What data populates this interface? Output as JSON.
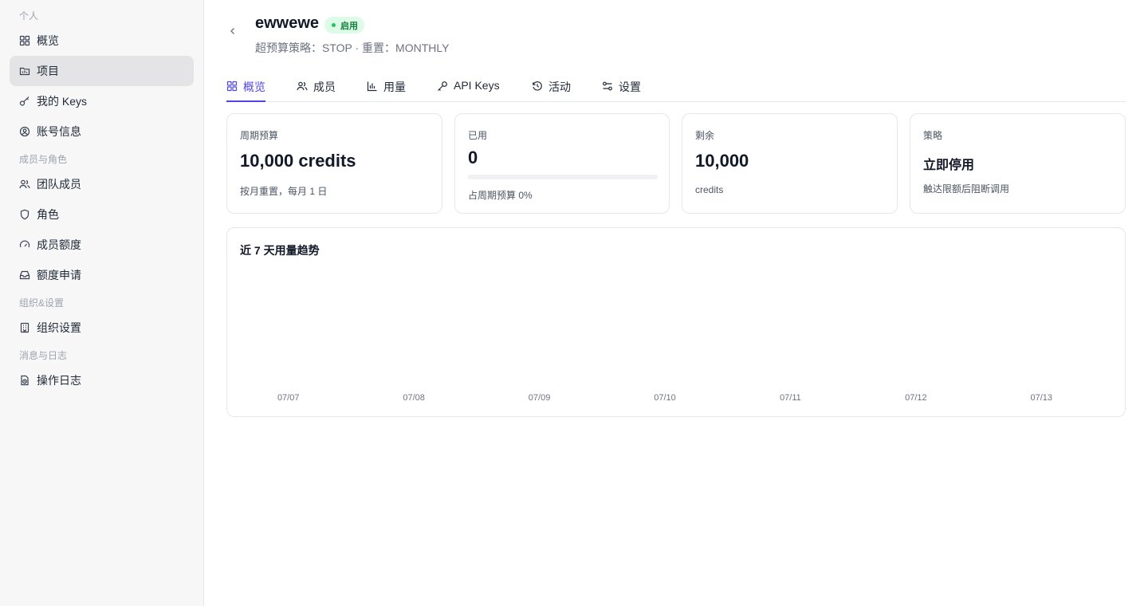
{
  "sidebar": {
    "sections": [
      {
        "label": "个人",
        "items": [
          {
            "label": "概览",
            "icon": "grid-icon"
          },
          {
            "label": "项目",
            "icon": "folder-icon",
            "active": true
          },
          {
            "label": "我的 Keys",
            "icon": "key-icon"
          },
          {
            "label": "账号信息",
            "icon": "user-circle-icon"
          }
        ]
      },
      {
        "label": "成员与角色",
        "items": [
          {
            "label": "团队成员",
            "icon": "users-icon"
          },
          {
            "label": "角色",
            "icon": "shield-icon"
          },
          {
            "label": "成员额度",
            "icon": "gauge-icon"
          },
          {
            "label": "额度申请",
            "icon": "inbox-icon"
          }
        ]
      },
      {
        "label": "组织&设置",
        "items": [
          {
            "label": "组织设置",
            "icon": "building-icon"
          }
        ]
      },
      {
        "label": "消息与日志",
        "items": [
          {
            "label": "操作日志",
            "icon": "log-icon"
          }
        ]
      }
    ]
  },
  "project": {
    "name": "ewwewe",
    "status": "启用",
    "subtitle": "超预算策略：STOP · 重置：MONTHLY"
  },
  "tabs": [
    {
      "label": "概览",
      "icon": "grid-icon",
      "active": true
    },
    {
      "label": "成员",
      "icon": "users-icon"
    },
    {
      "label": "用量",
      "icon": "bar-chart-icon"
    },
    {
      "label": "API Keys",
      "icon": "key-icon"
    },
    {
      "label": "活动",
      "icon": "history-icon"
    },
    {
      "label": "设置",
      "icon": "sliders-icon"
    }
  ],
  "cards": {
    "budget": {
      "label": "周期预算",
      "value": "10,000 credits",
      "note": "按月重置，每月 1 日"
    },
    "used": {
      "label": "已用",
      "value": "0",
      "note": "占周期预算 0%",
      "progress": 0
    },
    "remaining": {
      "label": "剩余",
      "value": "10,000",
      "note": "credits"
    },
    "policy": {
      "label": "策略",
      "value": "立即停用",
      "note": "触达限额后阻断调用"
    }
  },
  "colors": {
    "accent": "#4f46e5",
    "status_green": "#15803d",
    "status_bg": "#dcfce7"
  },
  "chart_data": {
    "type": "bar",
    "title": "近 7 天用量趋势",
    "categories": [
      "07/07",
      "07/08",
      "07/09",
      "07/10",
      "07/11",
      "07/12",
      "07/13"
    ],
    "values": [
      0,
      0,
      0,
      0,
      0,
      0,
      0
    ],
    "xlabel": "",
    "ylabel": "",
    "grid": false
  }
}
